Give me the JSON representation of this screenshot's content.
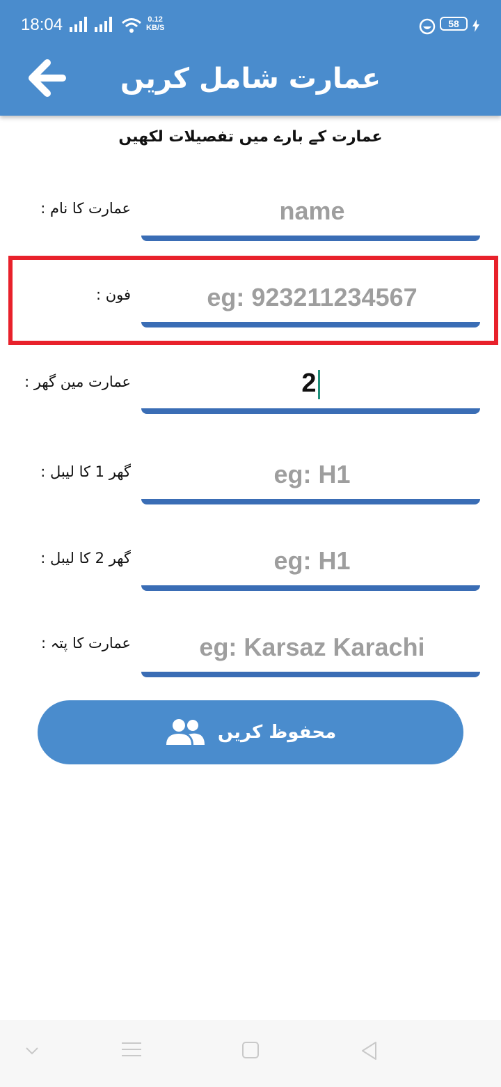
{
  "status_bar": {
    "time": "18:04",
    "net_speed_value": "0.12",
    "net_speed_unit": "KB/S",
    "battery": "58"
  },
  "header": {
    "title": "عمارت شامل کریں",
    "back_icon": "arrow-left-icon"
  },
  "subtitle": "عمارت کے بارے میں تفصیلات لکھیں",
  "form": {
    "name_label": "عمارت کا نام :",
    "name_placeholder": "name",
    "phone_label": "فون :",
    "phone_placeholder": "eg: 923211234567",
    "houses_label": "عمارت مین گھر :",
    "houses_value": "2",
    "house1_label": "گھر 1 کا لیبل :",
    "house1_placeholder": "eg: H1",
    "house2_label": "گھر 2 کا لیبل :",
    "house2_placeholder": "eg: H1",
    "address_label": "عمارت کا پتہ :",
    "address_placeholder": "eg: Karsaz Karachi"
  },
  "save_button": {
    "label": "محفوظ کریں",
    "icon": "people-icon"
  },
  "colors": {
    "primary": "#4a8ccd",
    "underline": "#3a6db5",
    "highlight": "#e8212b"
  }
}
